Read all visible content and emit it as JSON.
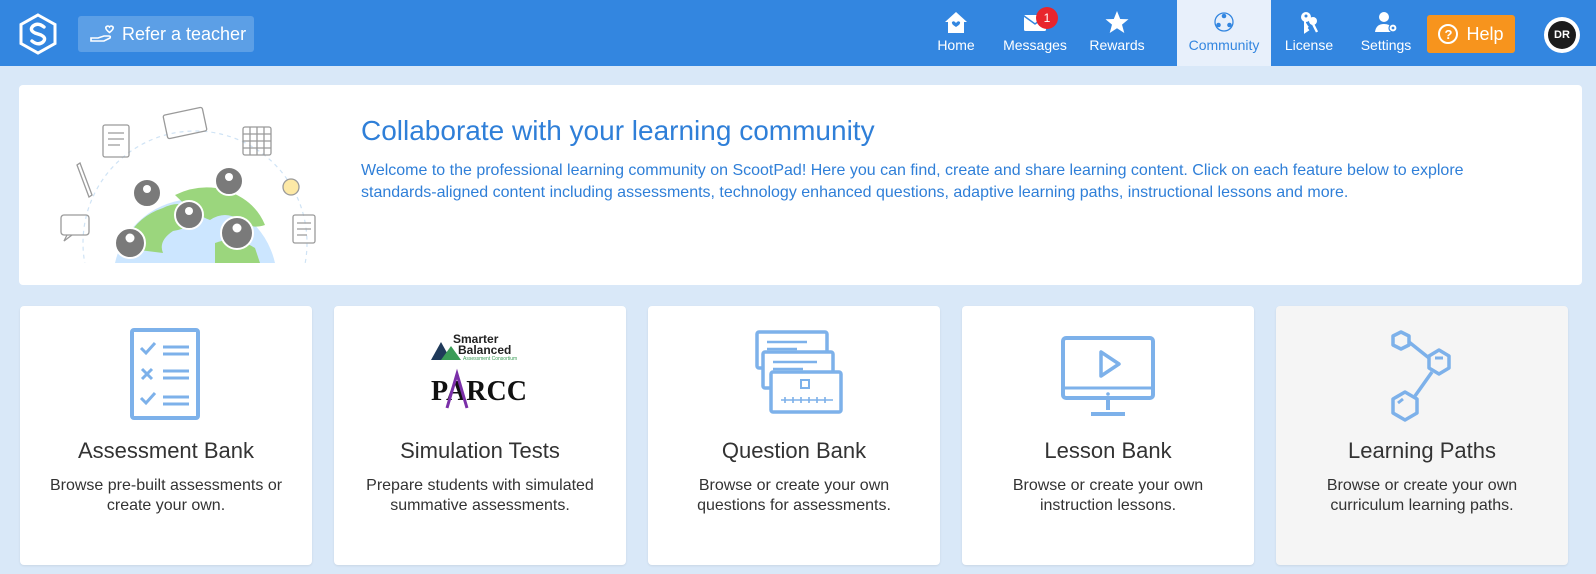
{
  "header": {
    "refer_label": "Refer a teacher",
    "nav": [
      {
        "label": "Home",
        "icon": "home-icon"
      },
      {
        "label": "Messages",
        "icon": "envelope-icon",
        "badge": "1"
      },
      {
        "label": "Rewards",
        "icon": "star-icon"
      },
      {
        "label": "Community",
        "icon": "community-icon",
        "active": true
      },
      {
        "label": "License",
        "icon": "keys-icon"
      },
      {
        "label": "Settings",
        "icon": "user-gear-icon"
      }
    ],
    "help_label": "Help",
    "avatar_initials": "DR"
  },
  "hero": {
    "title": "Collaborate with your learning community",
    "text": "Welcome to the professional learning community on ScootPad! Here you can find, create and share learning content. Click on each feature below to explore standards-aligned content including assessments, technology enhanced questions, adaptive learning paths, instructional lessons and more."
  },
  "cards": [
    {
      "title": "Assessment Bank",
      "desc": "Browse pre-built assessments or create your own.",
      "icon": "checklist-icon"
    },
    {
      "title": "Simulation Tests",
      "desc": "Prepare students with simulated summative assessments.",
      "icon": "smarter-balanced-parcc-logo",
      "logo_top_lines": [
        "Smarter",
        "Balanced"
      ],
      "logo_sub": "Assessment Consortium",
      "logo_bottom": "PARCC"
    },
    {
      "title": "Question Bank",
      "desc": "Browse or create your own questions for assessments.",
      "icon": "stacked-cards-icon"
    },
    {
      "title": "Lesson Bank",
      "desc": "Browse or create your own instruction lessons.",
      "icon": "monitor-play-icon"
    },
    {
      "title": "Learning Paths",
      "desc": "Browse or create your own curriculum learning paths.",
      "icon": "hexagon-path-icon"
    }
  ],
  "colors": {
    "topbar": "#3386e0",
    "accent_text": "#2f7fd8",
    "help": "#f7941d",
    "badge": "#e8252d",
    "page_bg": "#d9e8f8",
    "icon_blue": "#7db1ea"
  }
}
